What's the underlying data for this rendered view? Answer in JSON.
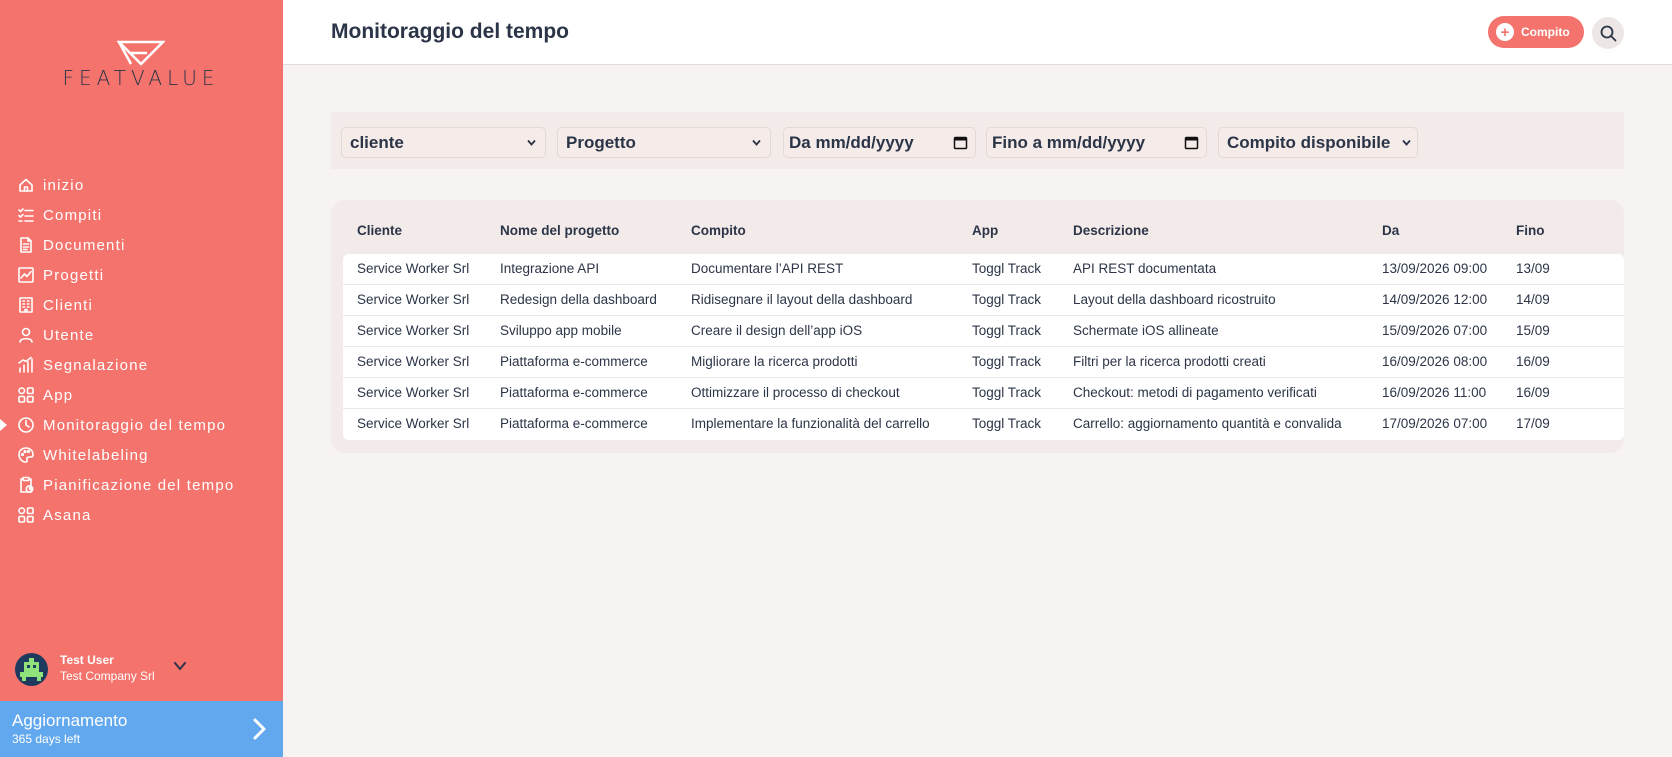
{
  "brand": {
    "logo_text": "FEATVALUE"
  },
  "sidebar": {
    "items": [
      {
        "label": "inizio",
        "icon": "home-icon",
        "active": false
      },
      {
        "label": "Compiti",
        "icon": "task-list-icon",
        "active": false
      },
      {
        "label": "Documenti",
        "icon": "document-icon",
        "active": false
      },
      {
        "label": "Progetti",
        "icon": "chart-icon",
        "active": false
      },
      {
        "label": "Clienti",
        "icon": "building-icon",
        "active": false
      },
      {
        "label": "Utente",
        "icon": "user-icon",
        "active": false
      },
      {
        "label": "Segnalazione",
        "icon": "bar-chart-icon",
        "active": false
      },
      {
        "label": "App",
        "icon": "apps-grid-icon",
        "active": false
      },
      {
        "label": "Monitoraggio del tempo",
        "icon": "clock-icon",
        "active": true
      },
      {
        "label": "Whitelabeling",
        "icon": "palette-icon",
        "active": false
      },
      {
        "label": "Pianificazione del tempo",
        "icon": "clipboard-clock-icon",
        "active": false
      },
      {
        "label": "Asana",
        "icon": "apps-grid-icon",
        "active": false
      }
    ],
    "user": {
      "name": "Test User",
      "company": "Test Company Srl"
    },
    "upgrade": {
      "title": "Aggiornamento",
      "subtitle": "365 days left"
    }
  },
  "header": {
    "title": "Monitoraggio del tempo",
    "add_task_label": "Compito"
  },
  "filters": {
    "client": "cliente",
    "project": "Progetto",
    "from": "Da mm/dd/yyyy",
    "to": "Fino a mm/dd/yyyy",
    "task": "Compito disponibile"
  },
  "table": {
    "columns": [
      "Cliente",
      "Nome del progetto",
      "Compito",
      "App",
      "Descrizione",
      "Da",
      "Fino"
    ],
    "rows": [
      [
        "Service Worker Srl",
        "Integrazione API",
        "Documentare l’API REST",
        "Toggl Track",
        "API REST documentata",
        "13/09/2026 09:00",
        "13/09"
      ],
      [
        "Service Worker Srl",
        "Redesign della dashboard",
        "Ridisegnare il layout della dashboard",
        "Toggl Track",
        "Layout della dashboard ricostruito",
        "14/09/2026 12:00",
        "14/09"
      ],
      [
        "Service Worker Srl",
        "Sviluppo app mobile",
        "Creare il design dell’app iOS",
        "Toggl Track",
        "Schermate iOS allineate",
        "15/09/2026 07:00",
        "15/09"
      ],
      [
        "Service Worker Srl",
        "Piattaforma e-commerce",
        "Migliorare la ricerca prodotti",
        "Toggl Track",
        "Filtri per la ricerca prodotti creati",
        "16/09/2026 08:00",
        "16/09"
      ],
      [
        "Service Worker Srl",
        "Piattaforma e-commerce",
        "Ottimizzare il processo di checkout",
        "Toggl Track",
        "Checkout: metodi di pagamento verificati",
        "16/09/2026 11:00",
        "16/09"
      ],
      [
        "Service Worker Srl",
        "Piattaforma e-commerce",
        "Implementare la funzionalità del carrello",
        "Toggl Track",
        "Carrello: aggiornamento quantità e convalida",
        "17/09/2026 07:00",
        "17/09"
      ]
    ]
  }
}
